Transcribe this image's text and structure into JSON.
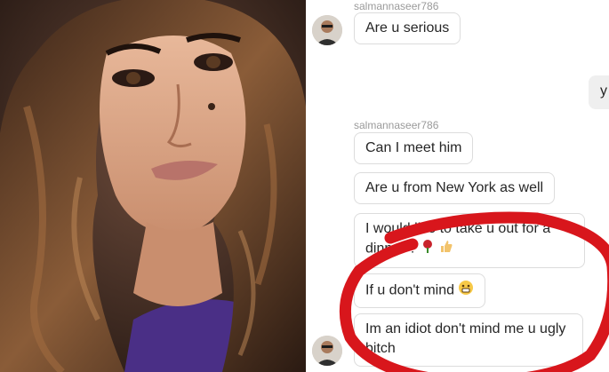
{
  "chat": {
    "sender_top": "salmannaseer786",
    "sender_middle": "salmannaseer786",
    "messages": [
      {
        "text": "Are u serious"
      },
      {
        "text": "y"
      },
      {
        "text": "Can I meet him"
      },
      {
        "text": "Are u from New York as well"
      },
      {
        "text": "I would like to take u out for a dinner ?"
      },
      {
        "text": "If u don't mind"
      },
      {
        "text": "Im an idiot don't mind me u ugly bitch"
      }
    ]
  },
  "colors": {
    "annotation_circle": "#d8161c",
    "bubble_border": "#dcdcdc",
    "own_bubble": "#efefef",
    "sender_text": "#9a9a9a"
  },
  "icons": [
    "grinning-face-emoji",
    "rose-emoji",
    "thumbs-up-emoji"
  ]
}
